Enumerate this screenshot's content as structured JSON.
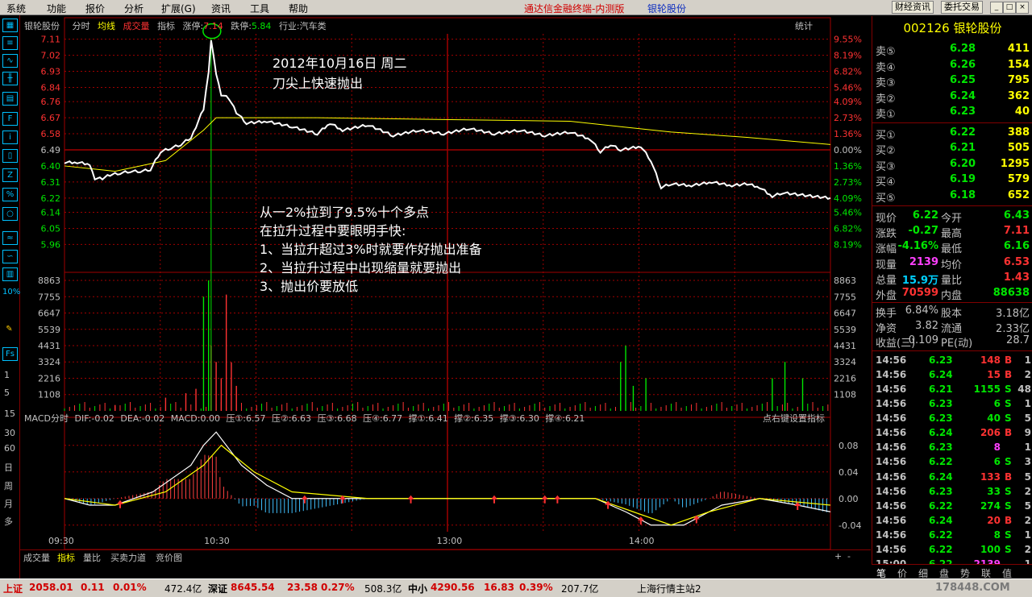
{
  "menu": {
    "items": [
      "系统",
      "功能",
      "报价",
      "分析",
      "扩展(G)",
      "资讯",
      "工具",
      "帮助"
    ],
    "app_title": "通达信金融终端-内测版",
    "stock_title": "银轮股份",
    "buttons": [
      "财经资讯",
      "委托交易"
    ]
  },
  "left_sidebar": {
    "periods": [
      "1",
      "5",
      "15",
      "30",
      "60",
      "日",
      "周",
      "月",
      "多"
    ]
  },
  "chart_header": {
    "stock": "银轮股份",
    "tabs": [
      "分时",
      "均线",
      "成交量",
      "指标"
    ],
    "limit_up_label": "涨停:",
    "limit_up": "7.14",
    "limit_down_label": "跌停:",
    "limit_down": "5.84",
    "industry": "行业:汽车类",
    "stats": "统计"
  },
  "annotations": {
    "date_line1": "2012年10月16日  周二",
    "date_line2": "刀尖上快速抛出",
    "note_lines": [
      "从一2%拉到了9.5%十个多点",
      "在拉升过程中要眼明手快:",
      "1、当拉升超过3%时就要作好抛出准备",
      "2、当拉升过程中出现缩量就要抛出",
      "3、抛出价要放低"
    ]
  },
  "macd_header": {
    "name": "MACD分时",
    "dif": "DIF:-0.02",
    "dea": "DEA:-0.02",
    "macd": "MACD:0.00",
    "levels": [
      "压①:6.57",
      "压②:6.63",
      "压③:6.68",
      "压④:6.77",
      "撑①:6.41",
      "撑②:6.35",
      "撑③:6.30",
      "撑④:6.21"
    ],
    "hint": "点右键设置指标"
  },
  "bottom_tabs": [
    "成交量",
    "指标",
    "量比",
    "买卖力道",
    "竞价图"
  ],
  "chart_data": {
    "type": "line",
    "prev_close": 6.49,
    "price_ticks_left": [
      "7.11",
      "7.02",
      "6.93",
      "6.84",
      "6.76",
      "6.67",
      "6.58",
      "6.49",
      "6.40",
      "6.31",
      "6.22",
      "6.14",
      "6.05",
      "5.96"
    ],
    "pct_ticks_right": [
      "9.55%",
      "8.19%",
      "6.82%",
      "5.46%",
      "4.09%",
      "2.73%",
      "1.36%",
      "0.00%",
      "1.36%",
      "2.73%",
      "4.09%",
      "5.46%",
      "6.82%",
      "8.19%"
    ],
    "volume_ticks": [
      "8863",
      "7755",
      "6647",
      "5539",
      "4431",
      "3324",
      "2216",
      "1108"
    ],
    "macd_ticks": [
      "0.08",
      "0.04",
      "0.00",
      "-0.04"
    ],
    "time_labels": [
      "09:30",
      "10:30",
      "13:00",
      "14:00"
    ],
    "price_series": [
      [
        0,
        6.42
      ],
      [
        5,
        6.42
      ],
      [
        10,
        6.41
      ],
      [
        12,
        6.33
      ],
      [
        15,
        6.33
      ],
      [
        18,
        6.35
      ],
      [
        22,
        6.36
      ],
      [
        26,
        6.37
      ],
      [
        30,
        6.37
      ],
      [
        34,
        6.38
      ],
      [
        38,
        6.48
      ],
      [
        42,
        6.5
      ],
      [
        46,
        6.52
      ],
      [
        50,
        6.56
      ],
      [
        52,
        6.62
      ],
      [
        55,
        6.72
      ],
      [
        57,
        6.93
      ],
      [
        58,
        7.11
      ],
      [
        60,
        6.92
      ],
      [
        62,
        6.8
      ],
      [
        65,
        6.78
      ],
      [
        68,
        6.7
      ],
      [
        72,
        6.64
      ],
      [
        80,
        6.65
      ],
      [
        90,
        6.62
      ],
      [
        100,
        6.58
      ],
      [
        105,
        6.64
      ],
      [
        110,
        6.6
      ],
      [
        120,
        6.63
      ],
      [
        130,
        6.57
      ],
      [
        140,
        6.6
      ],
      [
        150,
        6.58
      ],
      [
        160,
        6.61
      ],
      [
        170,
        6.58
      ],
      [
        180,
        6.6
      ],
      [
        190,
        6.57
      ],
      [
        200,
        6.59
      ],
      [
        208,
        6.55
      ],
      [
        212,
        6.48
      ],
      [
        216,
        6.52
      ],
      [
        220,
        6.49
      ],
      [
        228,
        6.51
      ],
      [
        232,
        6.43
      ],
      [
        236,
        6.28
      ],
      [
        240,
        6.3
      ],
      [
        248,
        6.29
      ],
      [
        256,
        6.31
      ],
      [
        264,
        6.29
      ],
      [
        270,
        6.3
      ],
      [
        275,
        6.28
      ],
      [
        280,
        6.23
      ],
      [
        284,
        6.25
      ],
      [
        290,
        6.24
      ],
      [
        296,
        6.23
      ],
      [
        303,
        6.22
      ]
    ],
    "avg_series": [
      [
        0,
        6.4
      ],
      [
        20,
        6.37
      ],
      [
        40,
        6.43
      ],
      [
        55,
        6.6
      ],
      [
        60,
        6.67
      ],
      [
        100,
        6.67
      ],
      [
        150,
        6.66
      ],
      [
        200,
        6.65
      ],
      [
        220,
        6.62
      ],
      [
        240,
        6.59
      ],
      [
        270,
        6.56
      ],
      [
        303,
        6.52
      ]
    ],
    "volume_bars": [
      [
        20,
        400
      ],
      [
        40,
        900
      ],
      [
        48,
        1200
      ],
      [
        52,
        1500
      ],
      [
        55,
        7755
      ],
      [
        57,
        8863
      ],
      [
        58,
        4431
      ],
      [
        60,
        3324
      ],
      [
        62,
        2216
      ],
      [
        64,
        7900
      ],
      [
        66,
        3300
      ],
      [
        68,
        1700
      ],
      [
        220,
        3324
      ],
      [
        222,
        4431
      ],
      [
        225,
        1700
      ],
      [
        230,
        2216
      ],
      [
        280,
        2216
      ],
      [
        285,
        3324
      ],
      [
        292,
        2216
      ]
    ],
    "macd_dif": [
      [
        0,
        0.0
      ],
      [
        10,
        -0.01
      ],
      [
        20,
        -0.01
      ],
      [
        35,
        0.01
      ],
      [
        50,
        0.05
      ],
      [
        55,
        0.08
      ],
      [
        60,
        0.1
      ],
      [
        70,
        0.05
      ],
      [
        80,
        0.02
      ],
      [
        90,
        0.0
      ],
      [
        120,
        0.0
      ],
      [
        180,
        0.0
      ],
      [
        210,
        0.0
      ],
      [
        222,
        -0.02
      ],
      [
        232,
        -0.04
      ],
      [
        245,
        -0.04
      ],
      [
        260,
        -0.01
      ],
      [
        275,
        0.0
      ],
      [
        290,
        -0.01
      ],
      [
        303,
        -0.02
      ]
    ],
    "macd_dea": [
      [
        0,
        0.0
      ],
      [
        20,
        -0.01
      ],
      [
        40,
        0.01
      ],
      [
        55,
        0.05
      ],
      [
        62,
        0.08
      ],
      [
        75,
        0.04
      ],
      [
        90,
        0.01
      ],
      [
        120,
        0.0
      ],
      [
        210,
        0.0
      ],
      [
        225,
        -0.02
      ],
      [
        240,
        -0.04
      ],
      [
        255,
        -0.02
      ],
      [
        275,
        0.0
      ],
      [
        303,
        -0.01
      ]
    ]
  },
  "quote": {
    "code": "002126",
    "name": "银轮股份",
    "asks": [
      {
        "label": "卖⑤",
        "price": "6.28",
        "vol": "411"
      },
      {
        "label": "卖④",
        "price": "6.26",
        "vol": "154"
      },
      {
        "label": "卖③",
        "price": "6.25",
        "vol": "795"
      },
      {
        "label": "卖②",
        "price": "6.24",
        "vol": "362"
      },
      {
        "label": "卖①",
        "price": "6.23",
        "vol": "40"
      }
    ],
    "bids": [
      {
        "label": "买①",
        "price": "6.22",
        "vol": "388"
      },
      {
        "label": "买②",
        "price": "6.21",
        "vol": "505"
      },
      {
        "label": "买③",
        "price": "6.20",
        "vol": "1295"
      },
      {
        "label": "买④",
        "price": "6.19",
        "vol": "579"
      },
      {
        "label": "买⑤",
        "price": "6.18",
        "vol": "652"
      }
    ],
    "stats": [
      {
        "l1": "现价",
        "v1": "6.22",
        "l2": "今开",
        "v2": "6.43"
      },
      {
        "l1": "涨跌",
        "v1": "-0.27",
        "l2": "最高",
        "v2": "7.11"
      },
      {
        "l1": "涨幅",
        "v1": "-4.16%",
        "l2": "最低",
        "v2": "6.16"
      },
      {
        "l1": "现量",
        "v1": "2139",
        "l2": "均价",
        "v2": "6.53"
      },
      {
        "l1": "总量",
        "v1": "15.9万",
        "l2": "量比",
        "v2": "1.43"
      },
      {
        "l1": "外盘",
        "v1": "70599",
        "l2": "内盘",
        "v2": "88638"
      }
    ],
    "stats2": [
      {
        "l1": "换手",
        "v1": "6.84%",
        "l2": "股本",
        "v2": "3.18亿"
      },
      {
        "l1": "净资",
        "v1": "3.82",
        "l2": "流通",
        "v2": "2.33亿"
      },
      {
        "l1": "收益(三)",
        "v1": "0.109",
        "l2": "PE(动)",
        "v2": "28.7"
      }
    ],
    "ticks": [
      {
        "t": "14:56",
        "p": "6.23",
        "v": "148",
        "s": "B",
        "n": "1"
      },
      {
        "t": "14:56",
        "p": "6.24",
        "v": "15",
        "s": "B",
        "n": "2"
      },
      {
        "t": "14:56",
        "p": "6.21",
        "v": "1155",
        "s": "S",
        "n": "48"
      },
      {
        "t": "14:56",
        "p": "6.23",
        "v": "6",
        "s": "S",
        "n": "1"
      },
      {
        "t": "14:56",
        "p": "6.23",
        "v": "40",
        "s": "S",
        "n": "5"
      },
      {
        "t": "14:56",
        "p": "6.24",
        "v": "206",
        "s": "B",
        "n": "9"
      },
      {
        "t": "14:56",
        "p": "6.23",
        "v": "8",
        "s": "",
        "n": "1"
      },
      {
        "t": "14:56",
        "p": "6.22",
        "v": "6",
        "s": "S",
        "n": "3"
      },
      {
        "t": "14:56",
        "p": "6.24",
        "v": "133",
        "s": "B",
        "n": "5"
      },
      {
        "t": "14:56",
        "p": "6.23",
        "v": "33",
        "s": "S",
        "n": "2"
      },
      {
        "t": "14:56",
        "p": "6.22",
        "v": "274",
        "s": "S",
        "n": "5"
      },
      {
        "t": "14:56",
        "p": "6.24",
        "v": "20",
        "s": "B",
        "n": "2"
      },
      {
        "t": "14:56",
        "p": "6.22",
        "v": "8",
        "s": "S",
        "n": "1"
      },
      {
        "t": "14:56",
        "p": "6.22",
        "v": "100",
        "s": "S",
        "n": "2"
      },
      {
        "t": "15:00",
        "p": "6.22",
        "v": "2139",
        "s": "",
        "n": "1"
      }
    ],
    "tabs": [
      "笔",
      "价",
      "细",
      "盘",
      "势",
      "联",
      "值"
    ]
  },
  "statusbar": {
    "sh_label": "上证",
    "sh_val": "2058.01",
    "sh_chg": "0.11",
    "sh_pct": "0.01%",
    "sh_amt": "472.4亿",
    "sz_label": "深证",
    "sz_val": "8645.54",
    "sz_chg": "23.58",
    "sz_pct": "0.27%",
    "sz_amt": "508.3亿",
    "zx_label": "中小",
    "zx_val": "4290.56",
    "zx_chg": "16.83",
    "zx_pct": "0.39%",
    "zx_amt": "207.7亿",
    "server": "上海行情主站2",
    "watermark": "178448.COM"
  }
}
